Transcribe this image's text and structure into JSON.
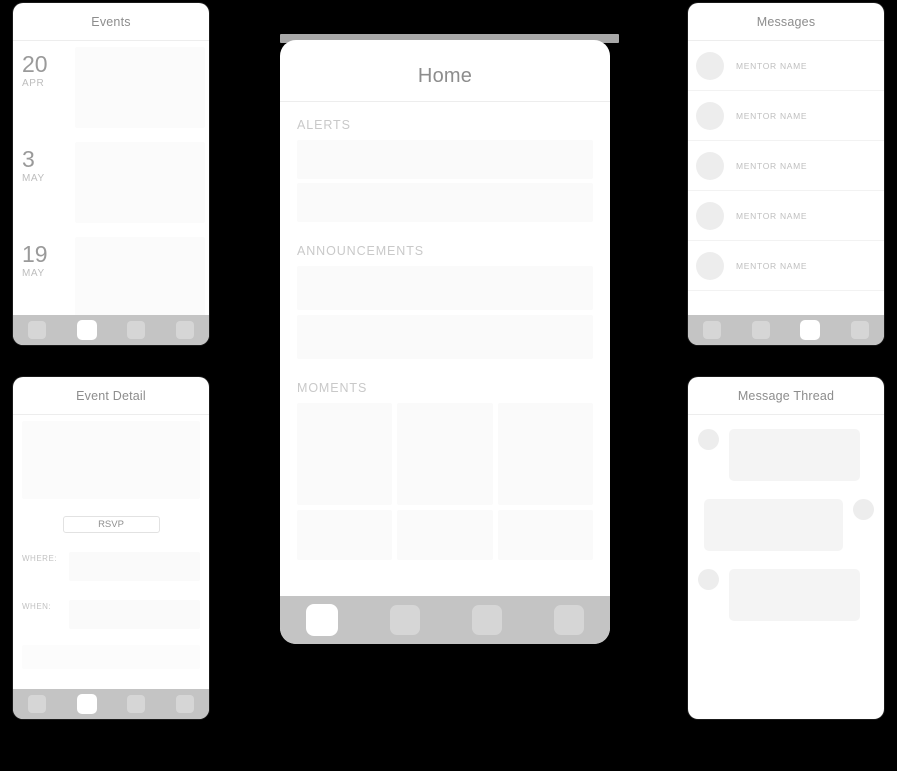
{
  "theme": {
    "background": "#000000",
    "panel_bg": "#ffffff",
    "tabbar_bg": "#c4c4c4",
    "tab_inactive": "#d6d6d6",
    "tab_active": "#ffffff",
    "placeholder_block": "#fafafa",
    "title_text": "#8d8d8d",
    "label_text": "#c9c9c9"
  },
  "events_screen": {
    "title": "Events",
    "rows": [
      {
        "day": "20",
        "month": "APR"
      },
      {
        "day": "3",
        "month": "MAY"
      },
      {
        "day": "19",
        "month": "MAY"
      }
    ],
    "tabs": [
      {
        "name": "tab-1",
        "active": false
      },
      {
        "name": "tab-2",
        "active": true
      },
      {
        "name": "tab-3",
        "active": false
      },
      {
        "name": "tab-4",
        "active": false
      }
    ]
  },
  "event_detail_screen": {
    "title": "Event Detail",
    "rsvp_label": "RSVP",
    "where_label": "WHERE:",
    "when_label": "WHEN:",
    "tabs": [
      {
        "name": "tab-1",
        "active": false
      },
      {
        "name": "tab-2",
        "active": true
      },
      {
        "name": "tab-3",
        "active": false
      },
      {
        "name": "tab-4",
        "active": false
      }
    ]
  },
  "home_screen": {
    "title": "Home",
    "sections": [
      {
        "label": "ALERTS",
        "rows": 2
      },
      {
        "label": "ANNOUNCEMENTS",
        "rows": 2
      },
      {
        "label": "MOMENTS",
        "cells": 3,
        "half_cells": 3
      }
    ],
    "tabs": [
      {
        "name": "tab-1",
        "active": true
      },
      {
        "name": "tab-2",
        "active": false
      },
      {
        "name": "tab-3",
        "active": false
      },
      {
        "name": "tab-4",
        "active": false
      }
    ]
  },
  "messages_screen": {
    "title": "Messages",
    "rows": [
      {
        "name": "MENTOR NAME"
      },
      {
        "name": "MENTOR NAME"
      },
      {
        "name": "MENTOR NAME"
      },
      {
        "name": "MENTOR NAME"
      },
      {
        "name": "MENTOR NAME"
      }
    ],
    "tabs": [
      {
        "name": "tab-1",
        "active": false
      },
      {
        "name": "tab-2",
        "active": false
      },
      {
        "name": "tab-3",
        "active": true
      },
      {
        "name": "tab-4",
        "active": false
      }
    ]
  },
  "message_thread_screen": {
    "title": "Message Thread",
    "bubbles": [
      {
        "side": "left"
      },
      {
        "side": "right"
      },
      {
        "side": "left"
      }
    ]
  }
}
